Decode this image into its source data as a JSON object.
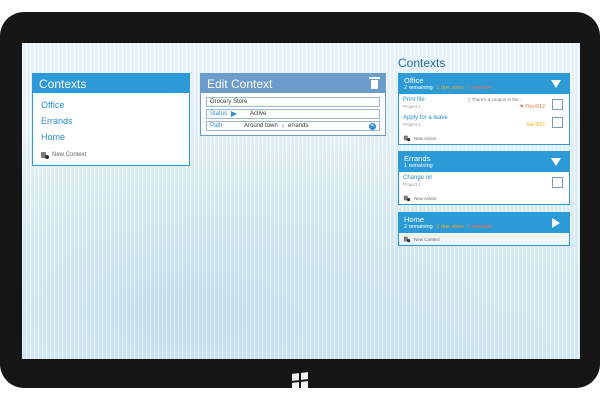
{
  "panel_contexts": {
    "title": "Contexts",
    "items": [
      "Office",
      "Errands",
      "Home"
    ],
    "new_label": "New Context"
  },
  "edit_context": {
    "title": "Edit Context",
    "name_value": "Grocery Store",
    "status_label": "Status",
    "status_value": "Active",
    "path_label": "Path",
    "path_parent": "Around town",
    "path_child": "errands"
  },
  "right_column": {
    "title": "Contexts",
    "contexts": [
      {
        "name": "Office",
        "remaining": "2 remaining",
        "due_soon": "1 due soon",
        "overdue": "1 overdue",
        "actions": [
          {
            "title": "Print file",
            "project": "Project 1",
            "note": "There's a coupon in the...",
            "date": "Thu 8/12",
            "overdue": true
          },
          {
            "title": "Apply for a leave",
            "project": "Project 1",
            "note": "",
            "date": "Sat 8/15",
            "overdue": false
          }
        ],
        "new_label": "New Action"
      },
      {
        "name": "Errands",
        "remaining": "1 remaining",
        "due_soon": "",
        "overdue": "",
        "actions": [
          {
            "title": "Change oil",
            "project": "Project 1",
            "note": "",
            "date": "",
            "overdue": false
          }
        ],
        "new_label": "New Action"
      },
      {
        "name": "Home",
        "remaining": "2 remaining",
        "due_soon": "1 due soon",
        "overdue": "1 overdue",
        "new_label": "New Context"
      }
    ]
  },
  "colors": {
    "accent": "#2c9ad6",
    "edit_header": "#6c9ccb",
    "due_soon": "#f6a623",
    "overdue": "#ff6a3d"
  },
  "icons": [
    "trash-icon",
    "play-icon",
    "chevron-right-icon",
    "clear-icon",
    "expand-down-icon",
    "expand-right-icon",
    "flag-icon",
    "note-icon",
    "new-icon",
    "windows-logo-icon"
  ]
}
